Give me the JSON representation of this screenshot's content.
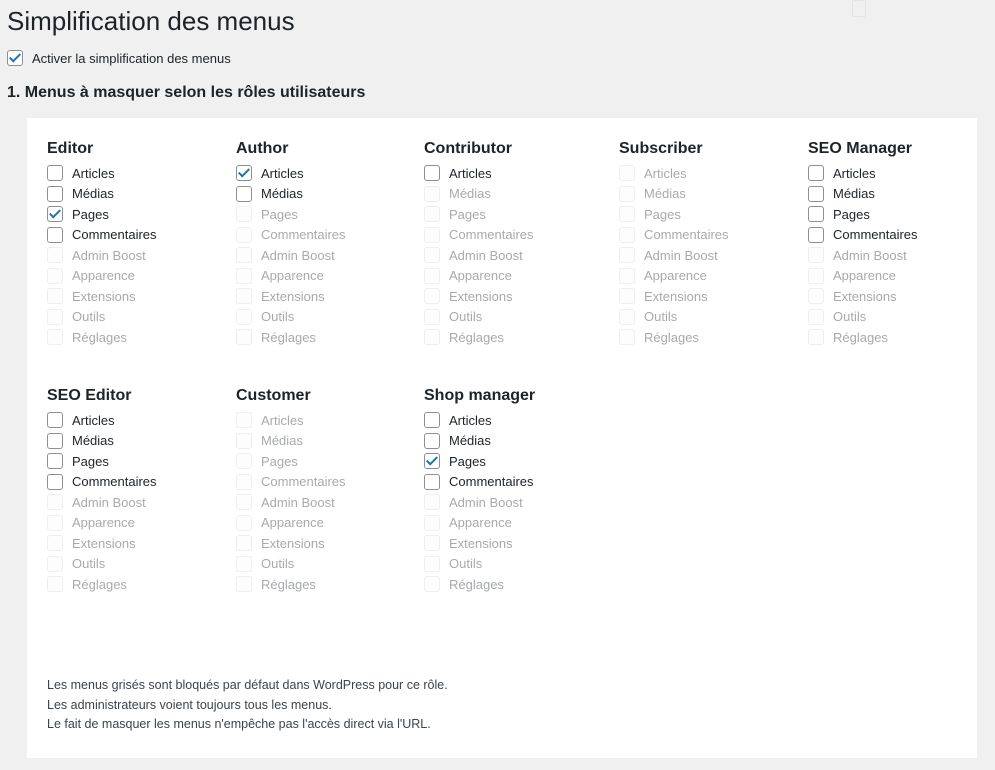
{
  "page": {
    "title": "Simplification des menus",
    "enable_label": "Activer la simplification des menus",
    "enable_checked": true,
    "section_heading": "1. Menus à masquer selon les rôles utilisateurs"
  },
  "roles": [
    {
      "name": "Editor",
      "items": [
        {
          "label": "Articles",
          "checked": false,
          "disabled": false
        },
        {
          "label": "Médias",
          "checked": false,
          "disabled": false
        },
        {
          "label": "Pages",
          "checked": true,
          "disabled": false
        },
        {
          "label": "Commentaires",
          "checked": false,
          "disabled": false
        },
        {
          "label": "Admin Boost",
          "checked": false,
          "disabled": true
        },
        {
          "label": "Apparence",
          "checked": false,
          "disabled": true
        },
        {
          "label": "Extensions",
          "checked": false,
          "disabled": true
        },
        {
          "label": "Outils",
          "checked": false,
          "disabled": true
        },
        {
          "label": "Réglages",
          "checked": false,
          "disabled": true
        }
      ]
    },
    {
      "name": "Author",
      "items": [
        {
          "label": "Articles",
          "checked": true,
          "disabled": false
        },
        {
          "label": "Médias",
          "checked": false,
          "disabled": false
        },
        {
          "label": "Pages",
          "checked": false,
          "disabled": true
        },
        {
          "label": "Commentaires",
          "checked": false,
          "disabled": true
        },
        {
          "label": "Admin Boost",
          "checked": false,
          "disabled": true
        },
        {
          "label": "Apparence",
          "checked": false,
          "disabled": true
        },
        {
          "label": "Extensions",
          "checked": false,
          "disabled": true
        },
        {
          "label": "Outils",
          "checked": false,
          "disabled": true
        },
        {
          "label": "Réglages",
          "checked": false,
          "disabled": true
        }
      ]
    },
    {
      "name": "Contributor",
      "items": [
        {
          "label": "Articles",
          "checked": false,
          "disabled": false
        },
        {
          "label": "Médias",
          "checked": false,
          "disabled": true
        },
        {
          "label": "Pages",
          "checked": false,
          "disabled": true
        },
        {
          "label": "Commentaires",
          "checked": false,
          "disabled": true
        },
        {
          "label": "Admin Boost",
          "checked": false,
          "disabled": true
        },
        {
          "label": "Apparence",
          "checked": false,
          "disabled": true
        },
        {
          "label": "Extensions",
          "checked": false,
          "disabled": true
        },
        {
          "label": "Outils",
          "checked": false,
          "disabled": true
        },
        {
          "label": "Réglages",
          "checked": false,
          "disabled": true
        }
      ]
    },
    {
      "name": "Subscriber",
      "items": [
        {
          "label": "Articles",
          "checked": false,
          "disabled": true
        },
        {
          "label": "Médias",
          "checked": false,
          "disabled": true
        },
        {
          "label": "Pages",
          "checked": false,
          "disabled": true
        },
        {
          "label": "Commentaires",
          "checked": false,
          "disabled": true
        },
        {
          "label": "Admin Boost",
          "checked": false,
          "disabled": true
        },
        {
          "label": "Apparence",
          "checked": false,
          "disabled": true
        },
        {
          "label": "Extensions",
          "checked": false,
          "disabled": true
        },
        {
          "label": "Outils",
          "checked": false,
          "disabled": true
        },
        {
          "label": "Réglages",
          "checked": false,
          "disabled": true
        }
      ]
    },
    {
      "name": "SEO Manager",
      "items": [
        {
          "label": "Articles",
          "checked": false,
          "disabled": false
        },
        {
          "label": "Médias",
          "checked": false,
          "disabled": false
        },
        {
          "label": "Pages",
          "checked": false,
          "disabled": false
        },
        {
          "label": "Commentaires",
          "checked": false,
          "disabled": false
        },
        {
          "label": "Admin Boost",
          "checked": false,
          "disabled": true
        },
        {
          "label": "Apparence",
          "checked": false,
          "disabled": true
        },
        {
          "label": "Extensions",
          "checked": false,
          "disabled": true
        },
        {
          "label": "Outils",
          "checked": false,
          "disabled": true
        },
        {
          "label": "Réglages",
          "checked": false,
          "disabled": true
        }
      ]
    },
    {
      "name": "SEO Editor",
      "items": [
        {
          "label": "Articles",
          "checked": false,
          "disabled": false
        },
        {
          "label": "Médias",
          "checked": false,
          "disabled": false
        },
        {
          "label": "Pages",
          "checked": false,
          "disabled": false
        },
        {
          "label": "Commentaires",
          "checked": false,
          "disabled": false
        },
        {
          "label": "Admin Boost",
          "checked": false,
          "disabled": true
        },
        {
          "label": "Apparence",
          "checked": false,
          "disabled": true
        },
        {
          "label": "Extensions",
          "checked": false,
          "disabled": true
        },
        {
          "label": "Outils",
          "checked": false,
          "disabled": true
        },
        {
          "label": "Réglages",
          "checked": false,
          "disabled": true
        }
      ]
    },
    {
      "name": "Customer",
      "items": [
        {
          "label": "Articles",
          "checked": false,
          "disabled": true
        },
        {
          "label": "Médias",
          "checked": false,
          "disabled": true
        },
        {
          "label": "Pages",
          "checked": false,
          "disabled": true
        },
        {
          "label": "Commentaires",
          "checked": false,
          "disabled": true
        },
        {
          "label": "Admin Boost",
          "checked": false,
          "disabled": true
        },
        {
          "label": "Apparence",
          "checked": false,
          "disabled": true
        },
        {
          "label": "Extensions",
          "checked": false,
          "disabled": true
        },
        {
          "label": "Outils",
          "checked": false,
          "disabled": true
        },
        {
          "label": "Réglages",
          "checked": false,
          "disabled": true
        }
      ]
    },
    {
      "name": "Shop manager",
      "items": [
        {
          "label": "Articles",
          "checked": false,
          "disabled": false
        },
        {
          "label": "Médias",
          "checked": false,
          "disabled": false
        },
        {
          "label": "Pages",
          "checked": true,
          "disabled": false
        },
        {
          "label": "Commentaires",
          "checked": false,
          "disabled": false
        },
        {
          "label": "Admin Boost",
          "checked": false,
          "disabled": true
        },
        {
          "label": "Apparence",
          "checked": false,
          "disabled": true
        },
        {
          "label": "Extensions",
          "checked": false,
          "disabled": true
        },
        {
          "label": "Outils",
          "checked": false,
          "disabled": true
        },
        {
          "label": "Réglages",
          "checked": false,
          "disabled": true
        }
      ]
    }
  ],
  "notes": [
    "Les menus grisés sont bloqués par défaut dans WordPress pour ce rôle.",
    "Les administrateurs voient toujours tous les menus.",
    "Le fait de masquer les menus n'empêche pas l'accès direct via l'URL."
  ],
  "colors": {
    "accent": "#2271b1",
    "background": "#f0f0f1",
    "panel": "#ffffff",
    "disabled_text": "#a7aaad"
  }
}
